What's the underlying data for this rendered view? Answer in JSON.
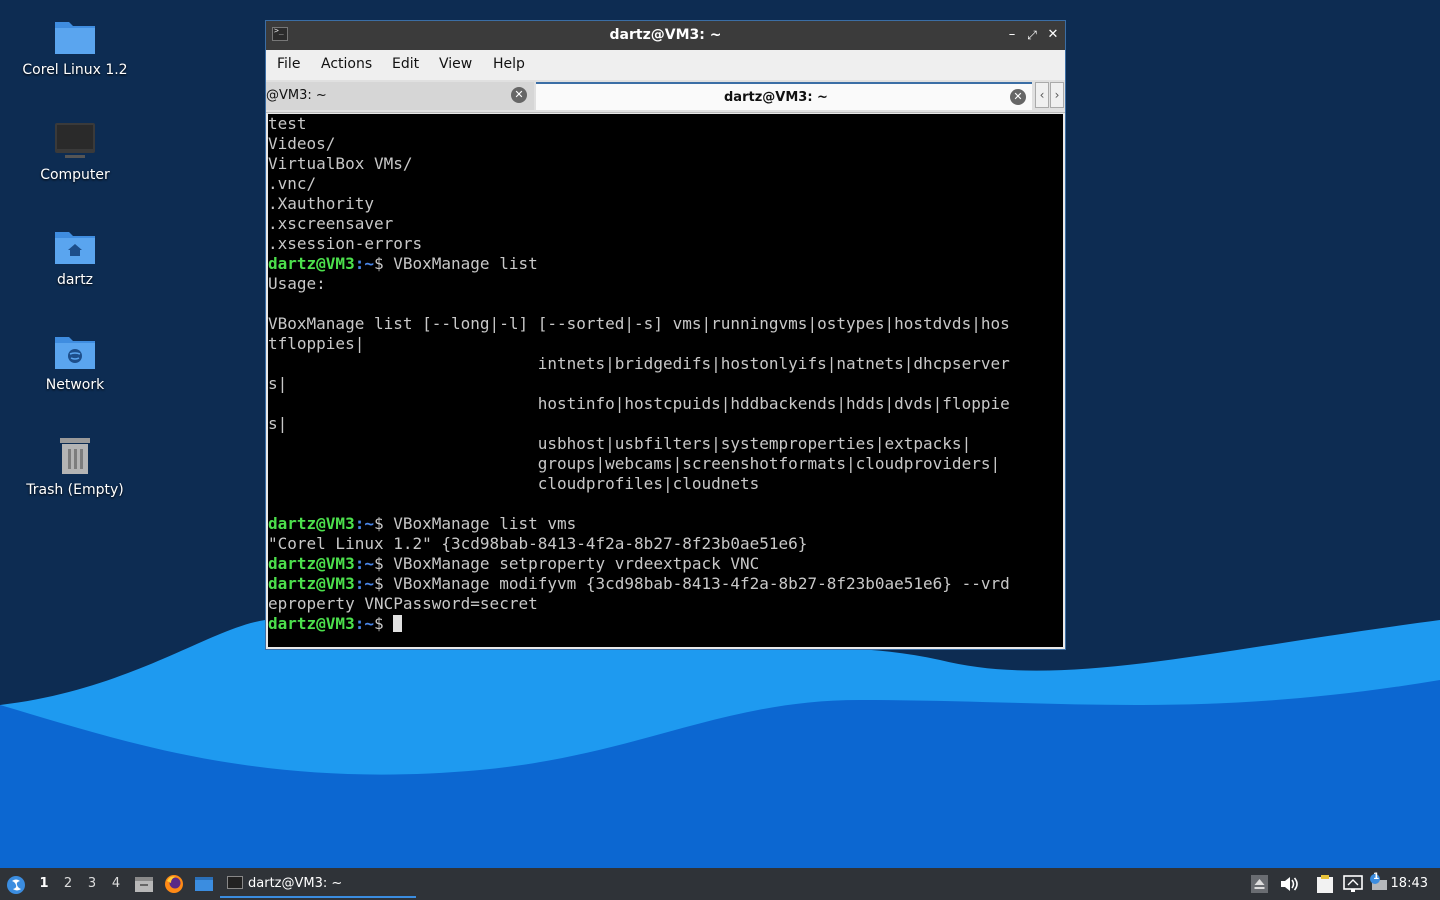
{
  "desktop": {
    "icons": [
      {
        "label": "Corel Linux 1.2",
        "icon": "folder-icon"
      },
      {
        "label": "Computer",
        "icon": "computer-icon"
      },
      {
        "label": "dartz",
        "icon": "home-folder-icon"
      },
      {
        "label": "Network",
        "icon": "network-folder-icon"
      },
      {
        "label": "Trash (Empty)",
        "icon": "trash-icon"
      }
    ]
  },
  "window": {
    "title": "dartz@VM3: ~",
    "menu": [
      "File",
      "Actions",
      "Edit",
      "View",
      "Help"
    ],
    "tabs": [
      {
        "label": "@VM3: ~",
        "active": false
      },
      {
        "label": "dartz@VM3: ~",
        "active": true
      }
    ]
  },
  "terminal": {
    "prompt_user": "dartz@VM3",
    "prompt_path": ":~",
    "prompt_symbol": "$ ",
    "lines": [
      {
        "text": "test"
      },
      {
        "text": "Videos/"
      },
      {
        "text": "VirtualBox VMs/"
      },
      {
        "text": ".vnc/"
      },
      {
        "text": ".Xauthority"
      },
      {
        "text": ".xscreensaver"
      },
      {
        "text": ".xsession-errors"
      },
      {
        "prompt": true,
        "text": "VBoxManage list"
      },
      {
        "text": "Usage:"
      },
      {
        "text": ""
      },
      {
        "text": "VBoxManage list [--long|-l] [--sorted|-s] vms|runningvms|ostypes|hostdvds|hos"
      },
      {
        "text": "tfloppies|"
      },
      {
        "text": "                            intnets|bridgedifs|hostonlyifs|natnets|dhcpserver"
      },
      {
        "text": "s|"
      },
      {
        "text": "                            hostinfo|hostcpuids|hddbackends|hdds|dvds|floppie"
      },
      {
        "text": "s|"
      },
      {
        "text": "                            usbhost|usbfilters|systemproperties|extpacks|"
      },
      {
        "text": "                            groups|webcams|screenshotformats|cloudproviders|"
      },
      {
        "text": "                            cloudprofiles|cloudnets"
      },
      {
        "text": ""
      },
      {
        "prompt": true,
        "text": "VBoxManage list vms"
      },
      {
        "text": "\"Corel Linux 1.2\" {3cd98bab-8413-4f2a-8b27-8f23b0ae51e6}"
      },
      {
        "prompt": true,
        "text": "VBoxManage setproperty vrdeextpack VNC"
      },
      {
        "prompt": true,
        "text": "VBoxManage modifyvm {3cd98bab-8413-4f2a-8b27-8f23b0ae51e6} --vrd"
      },
      {
        "text": "eproperty VNCPassword=secret"
      },
      {
        "prompt": true,
        "text": "",
        "cursor": true
      }
    ]
  },
  "taskbar": {
    "workspaces": [
      "1",
      "2",
      "3",
      "4"
    ],
    "active_workspace": "1",
    "task_label": "dartz@VM3: ~",
    "clock": "18:43",
    "notification_badge": "1"
  },
  "colors": {
    "desktop_bg": "#0d2c52",
    "wave_light": "#1e9af0",
    "wave_dark": "#0c67d1",
    "prompt_user": "#4ce04c",
    "prompt_path": "#4a86e8",
    "accent": "#3b6ea5"
  }
}
